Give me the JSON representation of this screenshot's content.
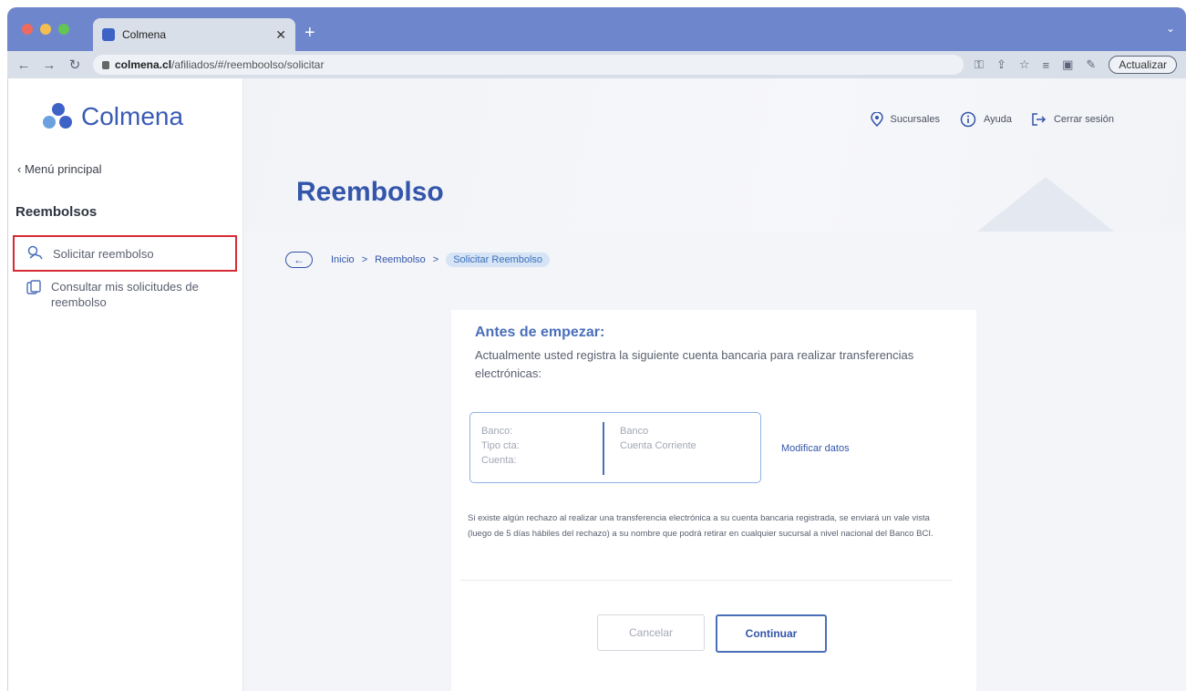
{
  "browser": {
    "tab_title": "Colmena",
    "url_host": "colmena.cl",
    "url_path": "/afiliados/#/reemboolso/solicitar",
    "update_label": "Actualizar"
  },
  "header": {
    "logo_text": "Colmena",
    "links": {
      "branches": "Sucursales",
      "help": "Ayuda",
      "logout": "Cerrar sesión"
    },
    "page_title": "Reembolso"
  },
  "sidebar": {
    "back_label": "‹ Menú principal",
    "section_title": "Reembolsos",
    "items": [
      {
        "label": "Solicitar reembolso"
      },
      {
        "label": "Consultar mis solicitudes de reembolso"
      }
    ]
  },
  "breadcrumb": {
    "items": [
      "Inicio",
      "Reembolso"
    ],
    "separator": ">",
    "current": "Solicitar Reembolso"
  },
  "card": {
    "heading": "Antes de empezar:",
    "intro": "Actualmente usted registra la siguiente cuenta bancaria para realizar transferencias electrónicas:",
    "account": {
      "labels": [
        "Banco:",
        "Tipo cta:",
        "Cuenta:"
      ],
      "values": [
        "Banco",
        "Cuenta Corriente",
        ""
      ]
    },
    "modify_link": "Modificar datos",
    "notice": "Si existe algún rechazo al realizar una transferencia electrónica a su cuenta bancaria registrada, se enviará un vale vista (luego de 5 días hábiles del rechazo) a su nombre que podrá retirar en cualquier sucursal a nivel nacional del Banco BCI.",
    "cancel_label": "Cancelar",
    "continue_label": "Continuar"
  },
  "colors": {
    "brand_blue": "#3355aa",
    "highlight_red": "#d62b34"
  }
}
